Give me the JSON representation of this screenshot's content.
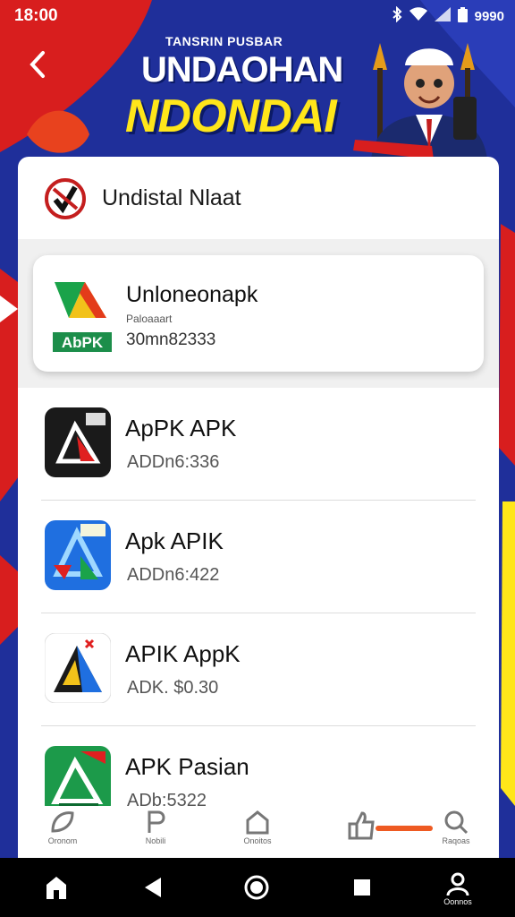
{
  "status_bar": {
    "time": "18:00",
    "battery_text": "9990"
  },
  "banner": {
    "small_text": "TANSRIN PUSBAR",
    "line1": "UNDAOHAN",
    "line2": "NDONDAI"
  },
  "header": {
    "title": "Undistal Nlaat"
  },
  "featured_app": {
    "name": "Unloneonapk",
    "subtitle": "Paloaaart",
    "size": "30mn82333",
    "icon_text": "AbPK"
  },
  "apps": [
    {
      "name": "ApPK APK",
      "size": "ADDn6:336",
      "icon": "apk-icon-dark"
    },
    {
      "name": "Apk APIK",
      "size": "ADDn6:422",
      "icon": "apk-icon-blue"
    },
    {
      "name": "APIK AppK",
      "size": "ADK. $0.30",
      "icon": "apk-icon-triangle"
    },
    {
      "name": "APK Pasian",
      "size": "ADb:5322",
      "icon": "apk-icon-green"
    }
  ],
  "tabs": [
    {
      "label": "Oronom",
      "icon": "leaf-icon"
    },
    {
      "label": "Nobili",
      "icon": "p-icon"
    },
    {
      "label": "Onoitos",
      "icon": "house-icon"
    },
    {
      "label": "",
      "icon": "thumbs-up-icon"
    },
    {
      "label": "Raqoas",
      "icon": "search-icon"
    }
  ],
  "nav_bar": {
    "profile_label": "Oonnos"
  },
  "colors": {
    "accent": "#ee5a22",
    "banner_yellow": "#ffe61a",
    "banner_blue": "#1f2f9a",
    "banner_red": "#d81e1e"
  }
}
